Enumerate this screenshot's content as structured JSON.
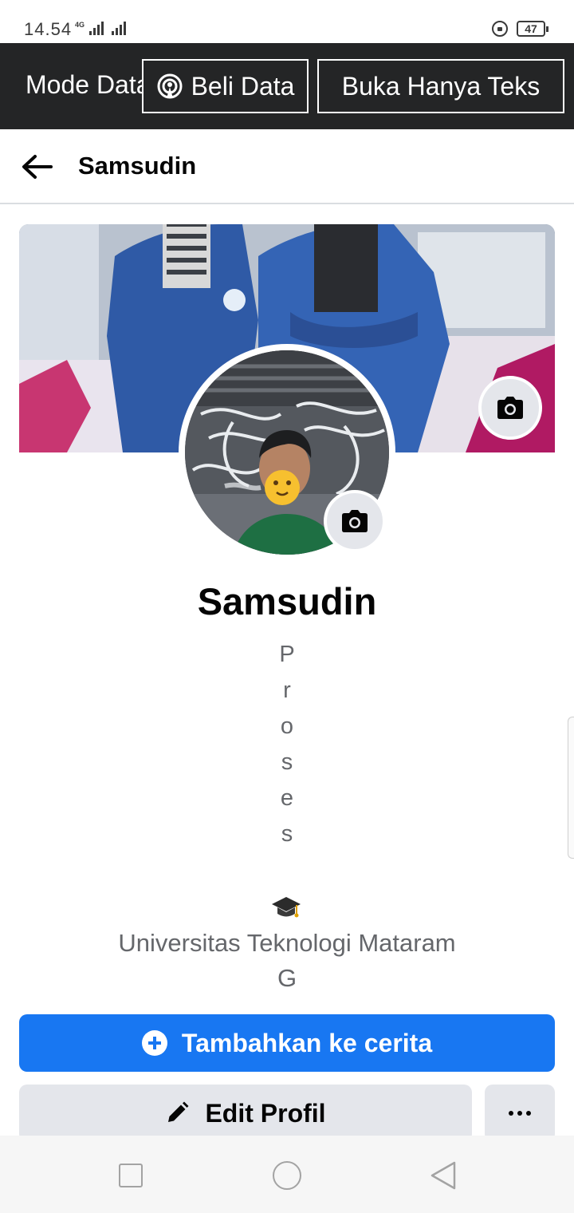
{
  "status_bar": {
    "time": "14.54",
    "network": "4G",
    "battery": "47"
  },
  "data_banner": {
    "mode_label": "Mode Data",
    "buy_data_label": "Beli Data",
    "text_only_label": "Buka Hanya Teks"
  },
  "header": {
    "title": "Samsudin"
  },
  "profile": {
    "name": "Samsudin",
    "bio_letters": [
      "P",
      "r",
      "o",
      "s",
      "e",
      "s"
    ],
    "education_line1": "Universitas Teknologi Mataram",
    "education_line2": "G"
  },
  "actions": {
    "story_label": "Tambahkan ke cerita",
    "edit_label": "Edit Profil"
  },
  "colors": {
    "primary": "#1877f2",
    "banner_bg": "#242526",
    "secondary_button": "#e4e6eb"
  },
  "icons": {
    "back": "arrow-left-icon",
    "camera": "camera-icon",
    "edit": "pencil-icon",
    "add": "plus-circle-icon",
    "more": "ellipsis-icon",
    "education": "graduation-cap-icon"
  }
}
